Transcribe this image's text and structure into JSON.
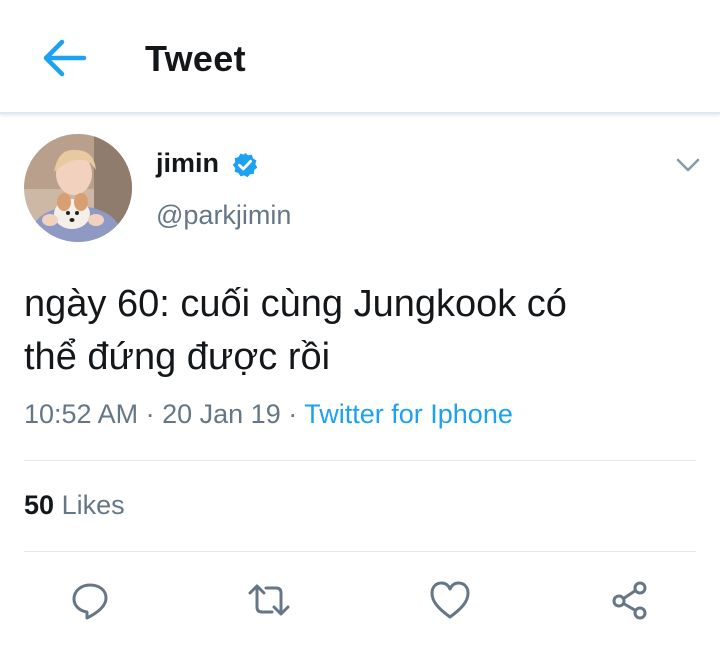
{
  "header": {
    "title": "Tweet",
    "back_icon": "arrow-left-icon"
  },
  "tweet": {
    "author": {
      "name": "jimin",
      "handle": "@parkjimin",
      "verified": true
    },
    "text_line1": "ngày 60: cuối cùng Jungkook có",
    "text_line2": "thể đứng được rồi",
    "time": "10:52 AM",
    "date": "20 Jan 19",
    "separator": "·",
    "source": "Twitter for Iphone",
    "likes_count": "50",
    "likes_label": "Likes"
  },
  "actions": [
    {
      "name": "reply",
      "icon": "reply-icon"
    },
    {
      "name": "retweet",
      "icon": "retweet-icon"
    },
    {
      "name": "like",
      "icon": "heart-icon"
    },
    {
      "name": "share",
      "icon": "share-icon"
    }
  ],
  "colors": {
    "accent": "#1da1f2",
    "text": "#14171a",
    "secondary": "#657786",
    "divider": "#e1e8ed",
    "icon_gray": "#657786"
  }
}
